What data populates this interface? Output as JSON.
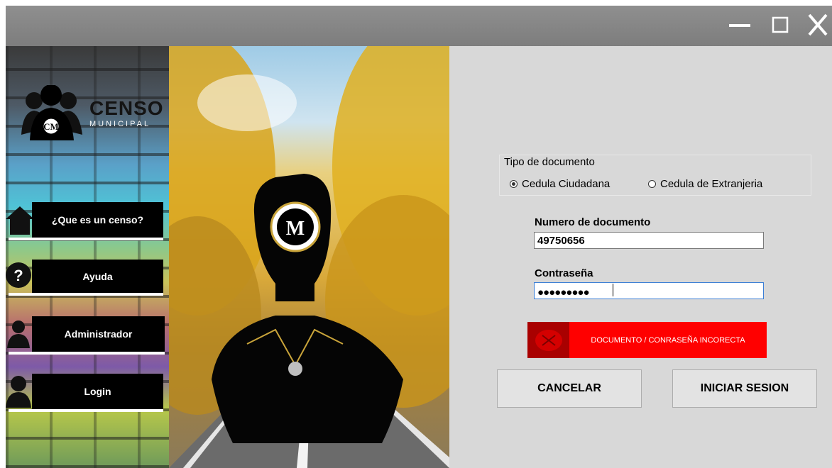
{
  "window": {
    "controls": {
      "minimize": "minimize",
      "maximize": "maximize",
      "close": "close"
    }
  },
  "sidebar": {
    "logo": {
      "title": "CENSO",
      "subtitle": "MUNICIPAL",
      "emblem_letters": "CM"
    },
    "items": [
      {
        "label": "¿Que es un censo?",
        "icon": "home-icon"
      },
      {
        "label": "Ayuda",
        "icon": "help-icon"
      },
      {
        "label": "Administrador",
        "icon": "admin-icon"
      },
      {
        "label": "Login",
        "icon": "user-icon"
      }
    ]
  },
  "form": {
    "doc_type_label": "Tipo de documento",
    "doc_type_options": [
      {
        "label": "Cedula Ciudadana",
        "selected": true
      },
      {
        "label": "Cedula de Extranjeria",
        "selected": false
      }
    ],
    "doc_number_label": "Numero de documento",
    "doc_number_value": "49750656",
    "password_label": "Contraseña",
    "password_value": "●●●●●●●●●",
    "error_message": "DOCUMENTO / CONRASEÑA INCORECTA",
    "cancel_label": "CANCELAR",
    "login_label": "INICIAR SESION"
  },
  "colors": {
    "error_bg": "#ff0000",
    "error_icon_bg": "#a90000",
    "titlebar": "#868686",
    "menu_bg": "#000000"
  }
}
